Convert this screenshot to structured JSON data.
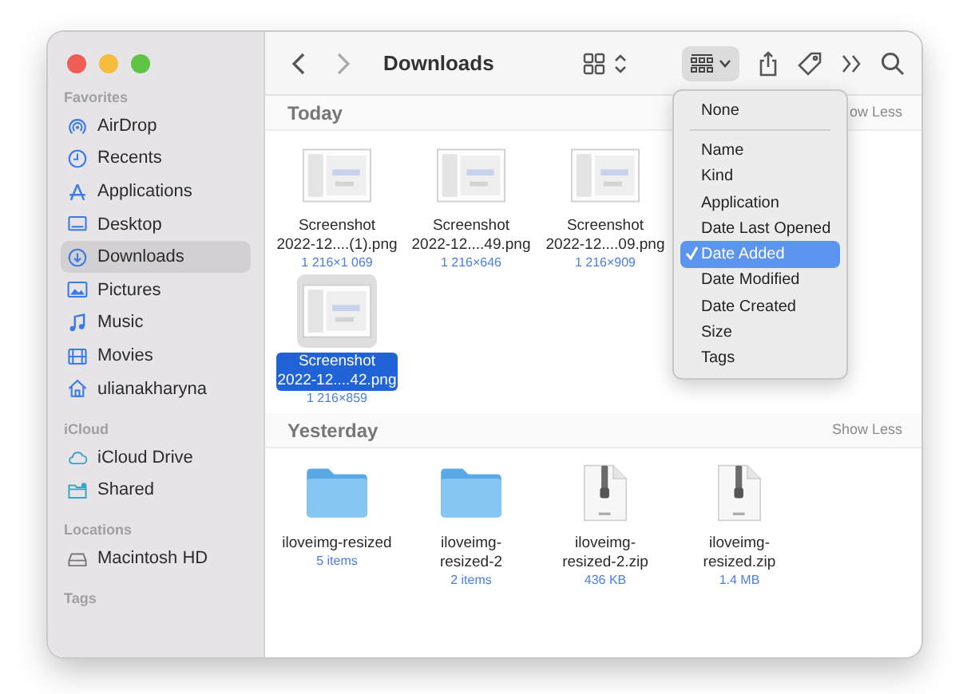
{
  "window": {
    "title": "Downloads"
  },
  "sidebar": {
    "sections": [
      {
        "header": "Favorites",
        "items": [
          {
            "label": "AirDrop",
            "selected": false
          },
          {
            "label": "Recents",
            "selected": false
          },
          {
            "label": "Applications",
            "selected": false
          },
          {
            "label": "Desktop",
            "selected": false
          },
          {
            "label": "Downloads",
            "selected": true
          },
          {
            "label": "Pictures",
            "selected": false
          },
          {
            "label": "Music",
            "selected": false
          },
          {
            "label": "Movies",
            "selected": false
          },
          {
            "label": "ulianakharyna",
            "selected": false
          }
        ]
      },
      {
        "header": "iCloud",
        "items": [
          {
            "label": "iCloud Drive",
            "selected": false
          },
          {
            "label": "Shared",
            "selected": false
          }
        ]
      },
      {
        "header": "Locations",
        "items": [
          {
            "label": "Macintosh HD",
            "selected": false
          }
        ]
      },
      {
        "header": "Tags"
      }
    ]
  },
  "groups": [
    {
      "title": "Today",
      "action": "ow Less",
      "rows": [
        [
          {
            "kind": "screenshot",
            "name": "Screenshot\n2022-12....(1).png",
            "info": "1 216×1 069",
            "selected": false
          },
          {
            "kind": "screenshot",
            "name": "Screenshot\n2022-12....49.png",
            "info": "1 216×646",
            "selected": false
          },
          {
            "kind": "screenshot",
            "name": "Screenshot\n2022-12....09.png",
            "info": "1 216×909",
            "selected": false
          }
        ],
        [
          {
            "kind": "screenshot",
            "name": "Screenshot\n2022-12....42.png",
            "info": "1 216×859",
            "selected": true
          }
        ]
      ]
    },
    {
      "title": "Yesterday",
      "action": "Show Less",
      "rows": [
        [
          {
            "kind": "folder",
            "name": "iloveimg-resized",
            "info": "5 items",
            "selected": false
          },
          {
            "kind": "folder",
            "name": "iloveimg-\nresized-2",
            "info": "2 items",
            "selected": false
          },
          {
            "kind": "zip",
            "name": "iloveimg-\nresized-2.zip",
            "info": "436 KB",
            "selected": false
          },
          {
            "kind": "zip",
            "name": "iloveimg-\nresized.zip",
            "info": "1.4 MB",
            "selected": false
          }
        ]
      ]
    }
  ],
  "group_menu": {
    "items": [
      {
        "kind": "item",
        "label": "None",
        "selected": false
      },
      {
        "kind": "separator"
      },
      {
        "kind": "item",
        "label": "Name",
        "selected": false
      },
      {
        "kind": "item",
        "label": "Kind",
        "selected": false
      },
      {
        "kind": "item",
        "label": "Application",
        "selected": false
      },
      {
        "kind": "item",
        "label": "Date Last Opened",
        "selected": false
      },
      {
        "kind": "item",
        "label": "Date Added",
        "selected": true
      },
      {
        "kind": "item",
        "label": "Date Modified",
        "selected": false
      },
      {
        "kind": "item",
        "label": "Date Created",
        "selected": false
      },
      {
        "kind": "item",
        "label": "Size",
        "selected": false
      },
      {
        "kind": "item",
        "label": "Tags",
        "selected": false
      }
    ]
  }
}
